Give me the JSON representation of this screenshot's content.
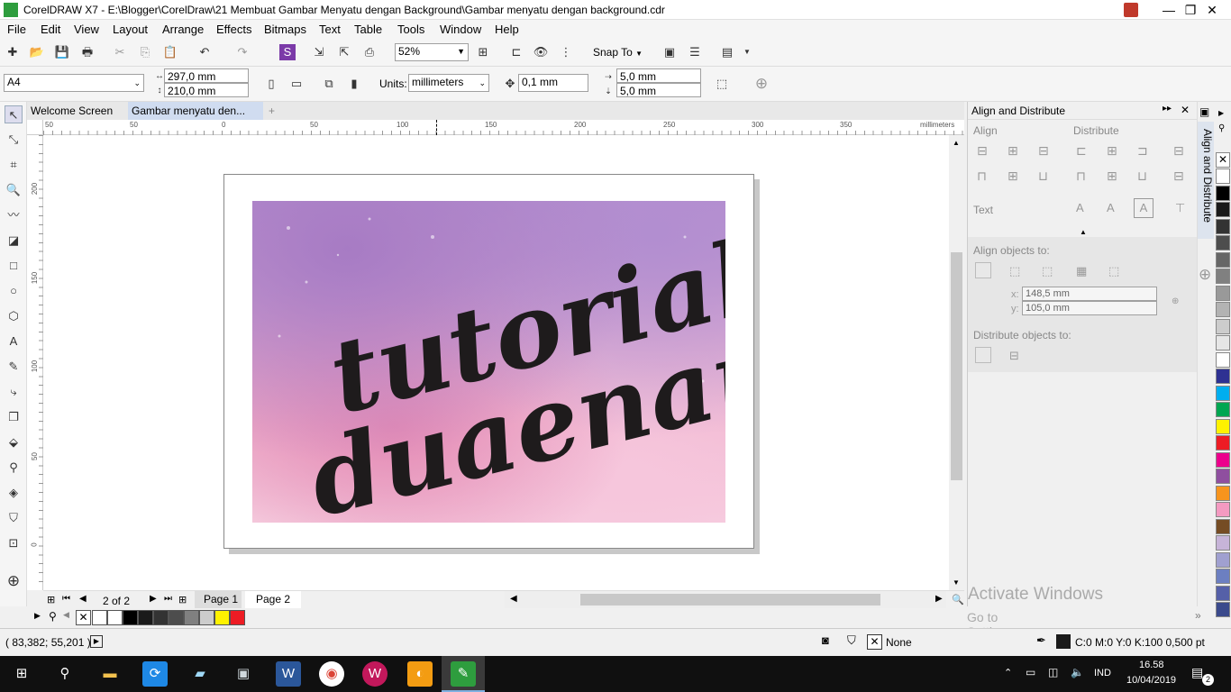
{
  "window": {
    "title": "CorelDRAW X7 - E:\\Blogger\\CorelDraw\\21 Membuat Gambar Menyatu dengan Background\\Gambar menyatu dengan background.cdr"
  },
  "menu": [
    "File",
    "Edit",
    "View",
    "Layout",
    "Arrange",
    "Effects",
    "Bitmaps",
    "Text",
    "Table",
    "Tools",
    "Window",
    "Help"
  ],
  "std_toolbar": {
    "zoom": "52%",
    "snap_to": "Snap To"
  },
  "prop_bar": {
    "page_size": "A4",
    "width": "297,0 mm",
    "height": "210,0 mm",
    "units_label": "Units:",
    "units": "millimeters",
    "nudge": "0,1 mm",
    "dup_x": "5,0 mm",
    "dup_y": "5,0 mm"
  },
  "doc_tabs": [
    "Welcome Screen",
    "Gambar menyatu den..."
  ],
  "ruler": {
    "h_ticks": [
      "0",
      "50",
      "100",
      "150",
      "200",
      "250",
      "300",
      "350"
    ],
    "h_neg": "50",
    "v_ticks": [
      "200",
      "150",
      "100",
      "50",
      "0"
    ],
    "unit": "millimeters"
  },
  "artwork": {
    "line1": "tutorial",
    "line2": "duaenam"
  },
  "pages": {
    "count": "2 of 2",
    "tabs": [
      "Page 1",
      "Page 2"
    ]
  },
  "docker": {
    "title": "Align and Distribute",
    "tab_label": "Align and Distribute",
    "align": "Align",
    "distribute": "Distribute",
    "text": "Text",
    "align_objects_to": "Align objects to:",
    "x": "148,5 mm",
    "y": "105,0 mm",
    "x_label": "x:",
    "y_label": "y:",
    "distribute_objects_to": "Distribute objects to:"
  },
  "watermark": {
    "line1": "Activate Windows",
    "line2": "Go to Settings to activate Windows."
  },
  "status": {
    "coords": "( 83,382; 55,201 )",
    "fill": "None",
    "outline": "C:0 M:0 Y:0 K:100  0,500 pt"
  },
  "taskbar": {
    "lang": "IND",
    "time": "16.58",
    "date": "10/04/2019",
    "notif": "2"
  },
  "palette_colors": [
    "#ffffff",
    "#000000",
    "#1a1a1a",
    "#333333",
    "#4d4d4d",
    "#666666",
    "#808080",
    "#999999",
    "#b3b3b3",
    "#cccccc",
    "#e6e6e6",
    "#ffffff",
    "#2e3192",
    "#00aeef",
    "#00a651",
    "#fff200",
    "#ed1c24",
    "#ec008c",
    "#8f4f9f",
    "#f7941d",
    "#f49ac1",
    "#754c24",
    "#c7b4d8",
    "#a0a0d0",
    "#6c7fc1",
    "#5560a8",
    "#3b4a8c"
  ],
  "doc_palette": [
    "#ffffff",
    "#ffffff",
    "#000000",
    "#1a1a1a",
    "#333333",
    "#4d4d4d",
    "#808080",
    "#cccccc",
    "#fff200",
    "#ed1c24"
  ]
}
